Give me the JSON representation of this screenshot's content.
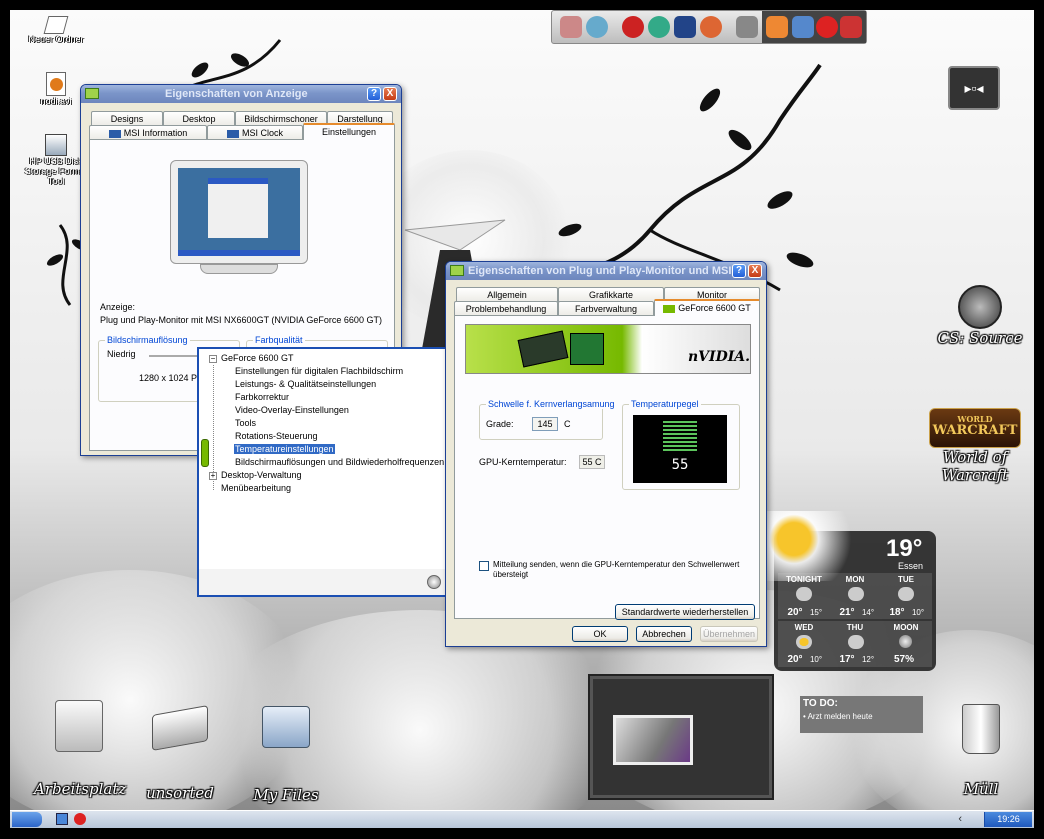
{
  "desktop_icons": [
    {
      "label": "Neuer Ordner",
      "icon": "folder-icon"
    },
    {
      "label": "nodi.avi",
      "icon": "media-file-icon"
    },
    {
      "label": "HP USB Disk Storage Format Tool",
      "icon": "usb-tool-icon"
    }
  ],
  "right_icons": [
    {
      "label": "CS: Source",
      "icon": "counter-strike-icon"
    },
    {
      "label": "World of Warcraft",
      "icon": "warcraft-icon",
      "logo_top": "WORLD",
      "logo_main": "WARCRAFT"
    }
  ],
  "bottom_icons": [
    {
      "label": "Arbeitsplatz",
      "icon": "computer-icon"
    },
    {
      "label": "unsorted",
      "icon": "scanner-icon"
    },
    {
      "label": "My Files",
      "icon": "folder-icon"
    },
    {
      "label": "Müll",
      "icon": "trash-icon"
    }
  ],
  "display_window": {
    "title": "Eigenschaften von Anzeige",
    "help_btn": "?",
    "close_btn": "X",
    "tabs_row1": [
      "Designs",
      "Desktop",
      "Bildschirmschoner",
      "Darstellung"
    ],
    "tabs_row2": [
      "MSI Information",
      "MSI Clock",
      "Einstellungen"
    ],
    "active_tab": "Einstellungen",
    "anzeige_label": "Anzeige:",
    "monitor_text": "Plug und Play-Monitor mit MSI NX6600GT (NVIDIA GeForce 6600 GT)",
    "resolution_group": "Bildschirmauflösung",
    "resolution_low": "Niedrig",
    "resolution_value": "1280 x 1024 Pixel",
    "color_group": "Farbqualität"
  },
  "pnp_window": {
    "title": "Eigenschaften von Plug und Play-Monitor und MSI...",
    "help_btn": "?",
    "close_btn": "X",
    "tabs_row1": [
      "Allgemein",
      "Grafikkarte",
      "Monitor"
    ],
    "tabs_row2": [
      "Problembehandlung",
      "Farbverwaltung",
      "GeForce 6600 GT"
    ],
    "active_tab": "GeForce 6600 GT",
    "banner_text": "nVIDIA.",
    "threshold_group": "Schwelle f. Kernverlangsamung",
    "grade_label": "Grade:",
    "grade_value": "145",
    "grade_unit": "C",
    "gauge_group": "Temperaturpegel",
    "gauge_value": "55",
    "gpu_temp_label": "GPU-Kerntemperatur:",
    "gpu_temp_value": "55 C",
    "notify_checkbox": "Mitteilung senden, wenn die GPU-Kerntemperatur den Schwellenwert übersteigt",
    "defaults_btn": "Standardwerte wiederherstellen",
    "ok_btn": "OK",
    "cancel_btn": "Abbrechen",
    "apply_btn": "Übernehmen"
  },
  "tree_popup": {
    "root": "GeForce 6600 GT",
    "children": [
      "Einstellungen für digitalen Flachbildschirm",
      "Leistungs- & Qualitätseinstellungen",
      "Farbkorrektur",
      "Video-Overlay-Einstellungen",
      "Tools",
      "Rotations-Steuerung",
      "Temperatureinstellungen",
      "Bildschirmauflösungen und Bildwiederholfrequenzen"
    ],
    "selected_index": 6,
    "other_roots": [
      "Desktop-Verwaltung",
      "Menübearbeitung"
    ],
    "expand_symbol": "+",
    "collapse_symbol": "−"
  },
  "weather": {
    "temp": "19°",
    "city": "Essen",
    "days_row1": [
      {
        "day": "TONIGHT",
        "hi": "20°",
        "lo": "15°"
      },
      {
        "day": "MON",
        "hi": "21°",
        "lo": "14°"
      },
      {
        "day": "TUE",
        "hi": "18°",
        "lo": "10°"
      }
    ],
    "days_row2": [
      {
        "day": "WED",
        "hi": "20°",
        "lo": "10°"
      },
      {
        "day": "THU",
        "hi": "17°",
        "lo": "12°"
      },
      {
        "day": "MOON",
        "value": "57%"
      }
    ]
  },
  "todo": {
    "title": "TO DO:",
    "item": "Arzt melden heute"
  },
  "taskbar": {
    "time": "19:26",
    "chevron": "‹"
  },
  "colors": {
    "xp_blue": "#1b5ad8",
    "nvidia_green": "#76b900",
    "selection": "#316ac5"
  }
}
